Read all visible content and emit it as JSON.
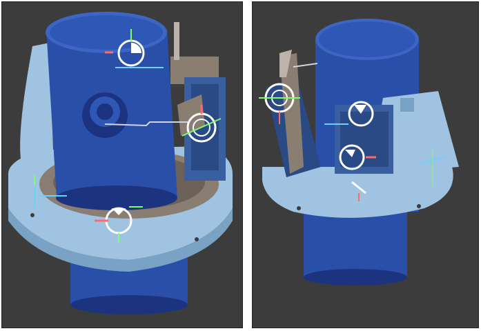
{
  "app": {
    "title": ""
  },
  "viewports": [
    {
      "id": "left",
      "view": "isometric"
    },
    {
      "id": "right",
      "view": "isometric-rotated"
    }
  ],
  "colors": {
    "background": "#3c3c3c",
    "cylinder_blue": "#2a4fa8",
    "cylinder_dark": "#1c3480",
    "mount_light": "#9fc3e0",
    "mount_shade": "#7aa2c4",
    "bracket_grey": "#8a7d72",
    "servo_blue": "#3a5fa0",
    "mate_white": "#ffffff",
    "axis_red": "#ff6a6a",
    "axis_green": "#7cff6a",
    "axis_cyan": "#6ad2ff"
  },
  "icons": [
    "mate-connector-icon",
    "triad-icon"
  ]
}
